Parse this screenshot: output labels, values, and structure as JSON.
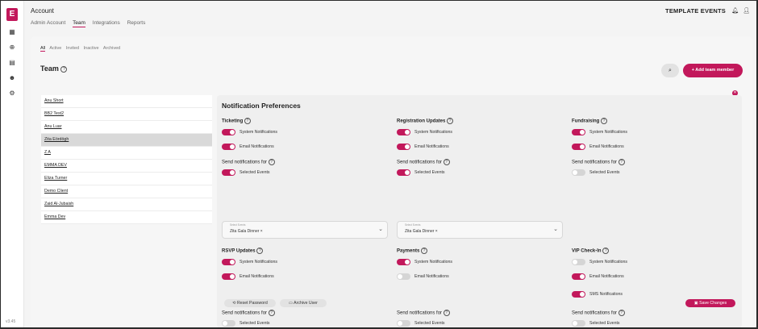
{
  "brand": {
    "logo_letter": "E",
    "accent": "#c2185b"
  },
  "rail": {
    "icons": [
      "calendar-icon",
      "globe-icon",
      "document-icon",
      "people-icon",
      "settings-icon"
    ],
    "version": "v3.45"
  },
  "header": {
    "title": "Account",
    "tabs": [
      {
        "label": "Admin Account"
      },
      {
        "label": "Team"
      },
      {
        "label": "Integrations"
      },
      {
        "label": "Reports"
      }
    ],
    "active_tab": "Team",
    "org_name": "TEMPLATE EVENTS"
  },
  "subtabs": [
    {
      "label": "All"
    },
    {
      "label": "Active"
    },
    {
      "label": "Invited"
    },
    {
      "label": "Inactive"
    },
    {
      "label": "Archived"
    }
  ],
  "team": {
    "title": "Team",
    "add_button": "Add team member",
    "members": [
      {
        "name": "Anu Short"
      },
      {
        "name": "BB2 Test2"
      },
      {
        "name": "Anu Luar"
      },
      {
        "name": "Zita Eördögh"
      },
      {
        "name": "Z A"
      },
      {
        "name": "EMMA DEV"
      },
      {
        "name": "Eliza Turner"
      },
      {
        "name": "Demo Client"
      },
      {
        "name": "Zaid Al-Jubaish"
      },
      {
        "name": "Emma Dev"
      }
    ],
    "selected_index": 3
  },
  "panel": {
    "title": "Notification Preferences",
    "system": "System Notifications",
    "email": "Email Notifications",
    "sms": "SMS Notifications",
    "send_for": "Send notifications for",
    "selected_events": "Selected Events",
    "select_label": "Select Events",
    "chip": "Zita Gala Dinner",
    "sections": {
      "ticketing": {
        "title": "Ticketing"
      },
      "registration": {
        "title": "Registration Updates"
      },
      "fundraising": {
        "title": "Fundraising"
      },
      "rsvp": {
        "title": "RSVP Updates"
      },
      "payments": {
        "title": "Payments"
      },
      "vip": {
        "title": "VIP Check-In"
      }
    }
  },
  "footer": {
    "reset": "Reset Password",
    "archive": "Archive User",
    "save": "Save Changes"
  }
}
